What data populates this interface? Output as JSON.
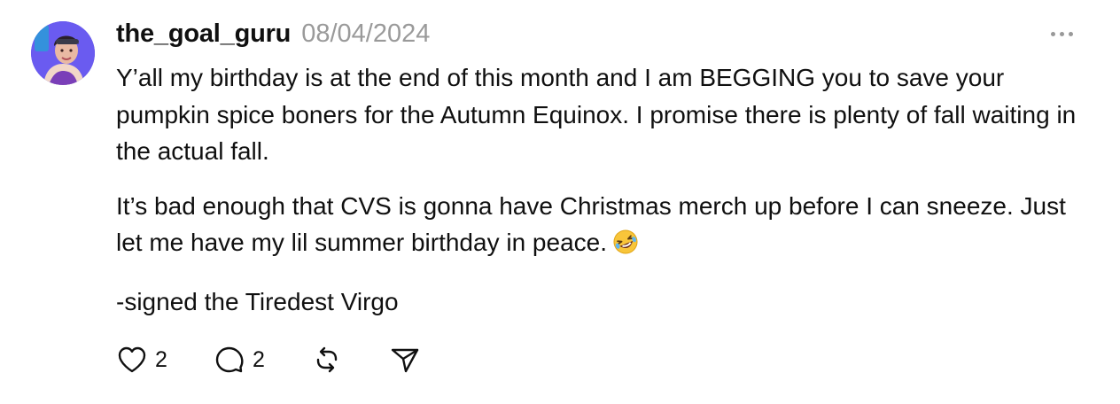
{
  "post": {
    "author": "the_goal_guru",
    "date": "08/04/2024",
    "paragraphs": [
      "Y’all my birthday is at the end of this month and I am BEGGING you to save your pumpkin spice boners for the Autumn Equinox. I promise there is plenty of fall waiting in the actual fall.",
      "It’s bad enough that CVS is gonna have Christmas merch up before I can sneeze. Just let me have my lil summer birthday in peace.",
      "-signed the Tiredest Virgo"
    ],
    "emoji": "rolling-on-floor-laughing-emoji"
  },
  "actions": {
    "like_count": "2",
    "reply_count": "2",
    "like_icon": "heart-icon",
    "reply_icon": "comment-icon",
    "repost_icon": "repost-icon",
    "share_icon": "send-icon"
  },
  "menu": {
    "icon": "more-options-icon"
  },
  "colors": {
    "text": "#101010",
    "muted": "#9a9a9a",
    "avatar_bg": "#5b49e0"
  }
}
